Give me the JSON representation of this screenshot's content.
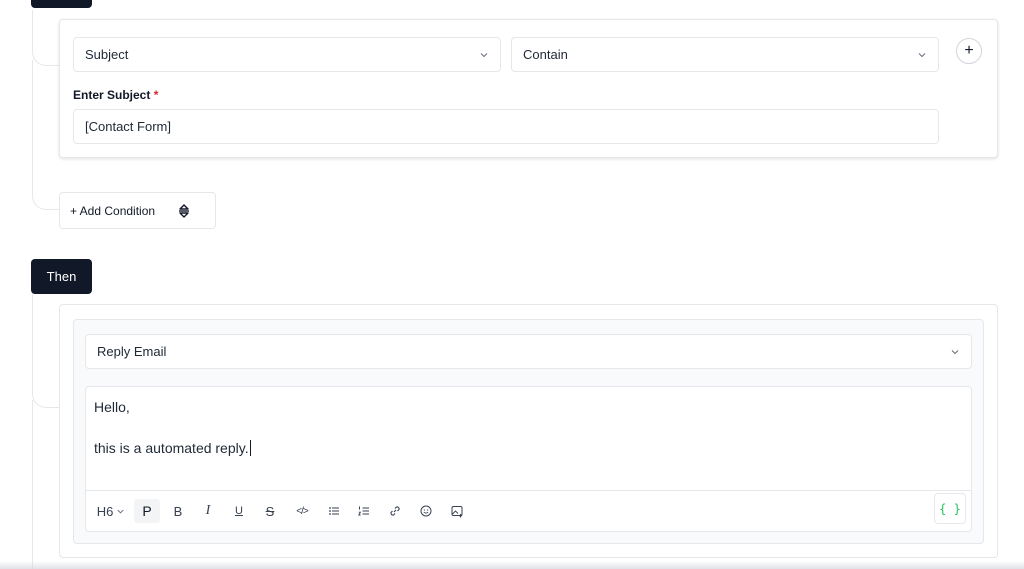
{
  "condition": {
    "field_select": {
      "value": "Subject"
    },
    "operator_select": {
      "value": "Contain"
    },
    "input_label": "Enter Subject",
    "required_mark": "*",
    "input_value": "[Contact Form]"
  },
  "add_condition_label": "+ Add Condition",
  "then_label": "Then",
  "action": {
    "action_select": {
      "value": "Reply Email"
    },
    "editor_lines": [
      "Hello,",
      "this is a automated reply."
    ]
  },
  "toolbar": {
    "heading_label": "H6",
    "paragraph_label": "P",
    "bold_label": "B",
    "italic_label": "I",
    "underline_label": "U",
    "strike_label": "S",
    "code_label": "</>",
    "variables_label": "{ }"
  },
  "colors": {
    "accent_dark": "#111827",
    "required": "#dc2626",
    "variables": "#22c55e"
  }
}
